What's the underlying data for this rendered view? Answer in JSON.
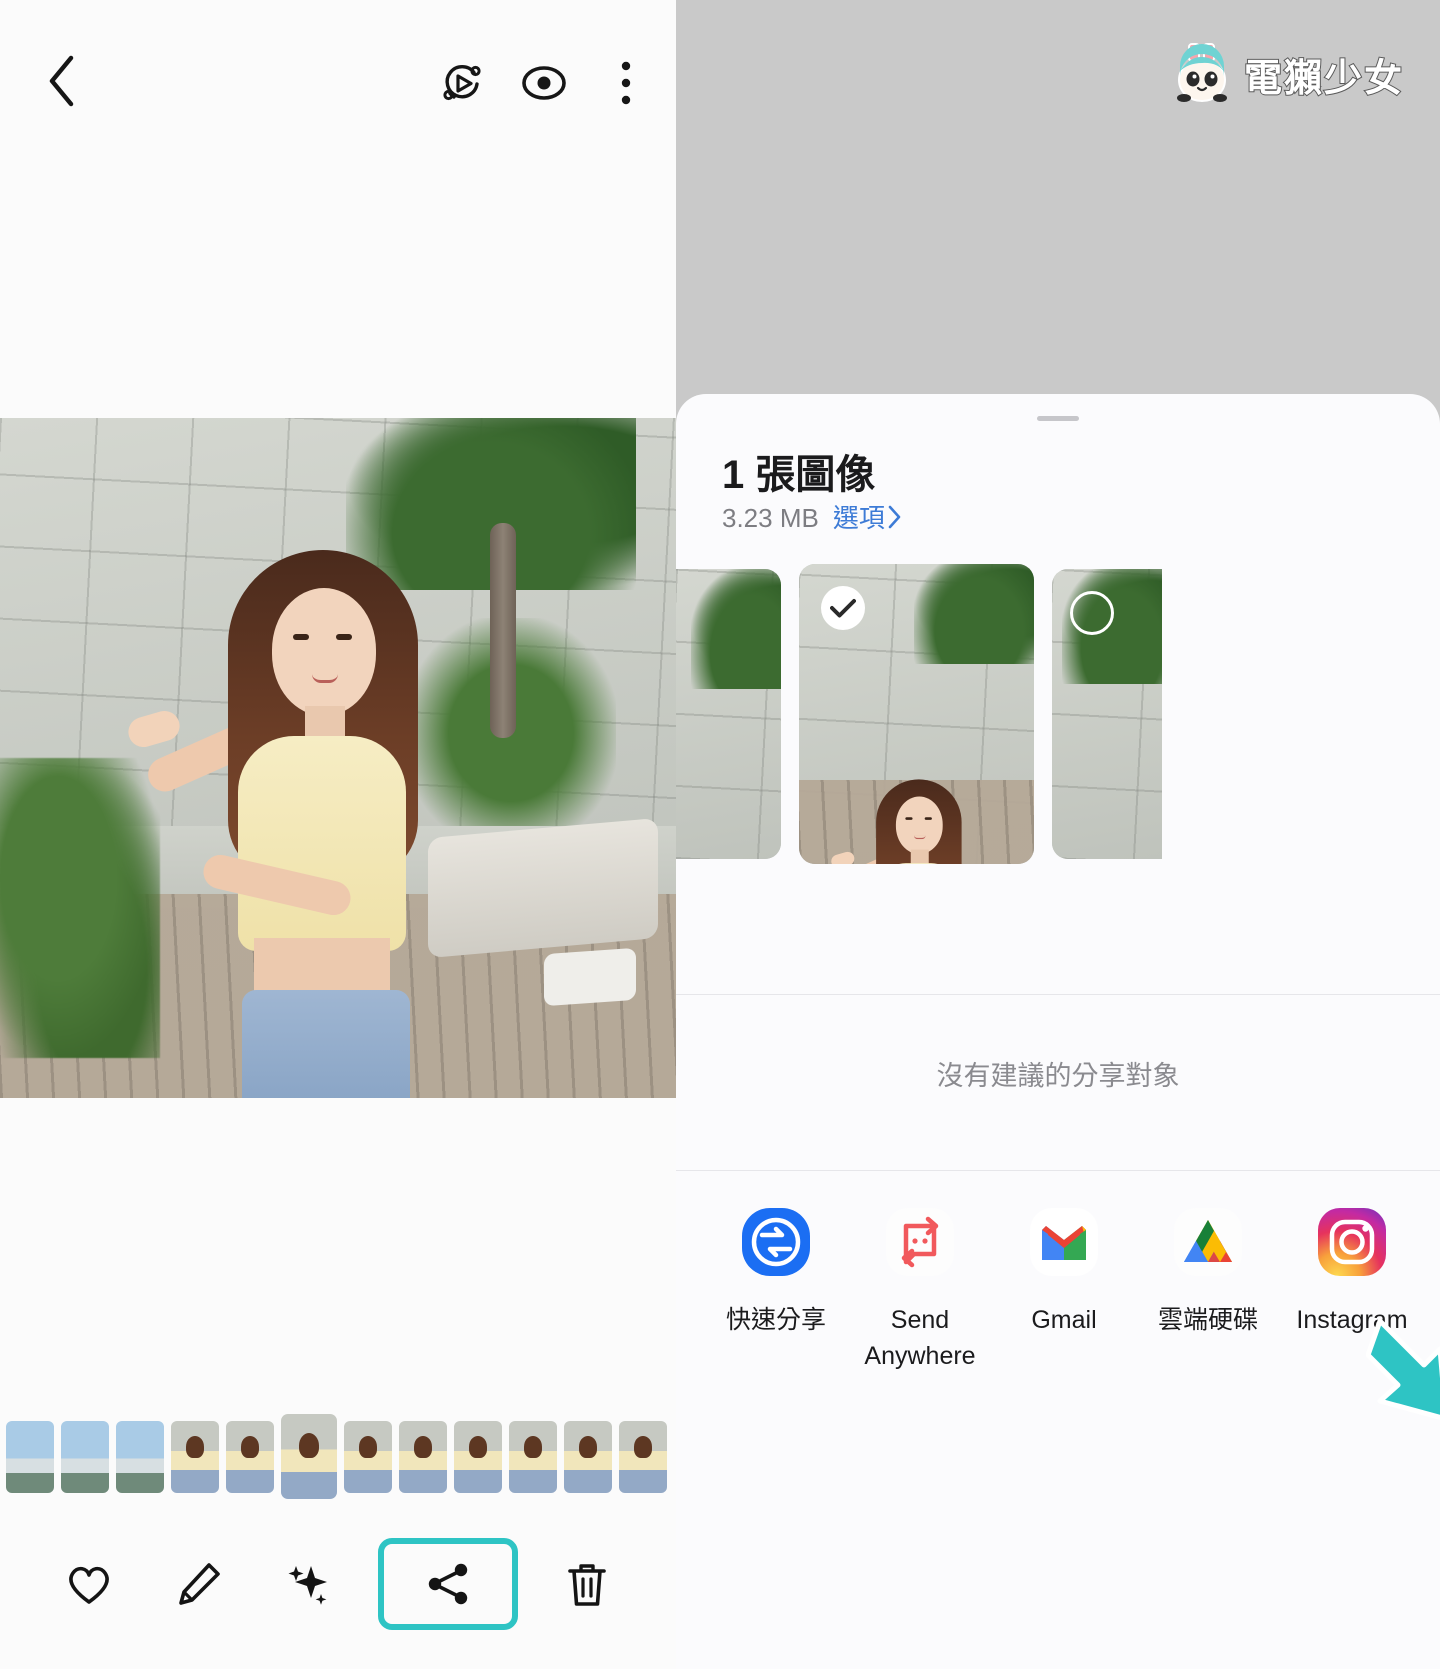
{
  "app": {
    "left_pane_name": "gallery-photo-viewer",
    "right_pane_name": "android-share-sheet"
  },
  "viewer": {
    "toolbar": {
      "back_label": "返回",
      "icons": [
        {
          "name": "back-chevron-icon",
          "label": "返回"
        },
        {
          "name": "motion-photo-icon",
          "label": "動態相片"
        },
        {
          "name": "eye-icon",
          "label": "檢視"
        },
        {
          "name": "overflow-menu-icon",
          "label": "更多選項"
        }
      ]
    },
    "bottom_actions": [
      {
        "name": "favorite-heart-icon",
        "label": "我的最愛",
        "highlighted": false
      },
      {
        "name": "edit-pencil-icon",
        "label": "編輯",
        "highlighted": false
      },
      {
        "name": "ai-sparkle-icon",
        "label": "智慧修圖",
        "highlighted": false
      },
      {
        "name": "share-icon",
        "label": "分享",
        "highlighted": true
      },
      {
        "name": "delete-trash-icon",
        "label": "刪除",
        "highlighted": false
      }
    ],
    "filmstrip": [
      {
        "type": "landscape"
      },
      {
        "type": "landscape"
      },
      {
        "type": "landscape"
      },
      {
        "type": "portrait"
      },
      {
        "type": "portrait"
      },
      {
        "type": "portrait",
        "current": true
      },
      {
        "type": "portrait"
      },
      {
        "type": "portrait"
      },
      {
        "type": "portrait"
      },
      {
        "type": "portrait"
      },
      {
        "type": "portrait"
      }
    ]
  },
  "watermark": {
    "text": "電獺少女",
    "mascot_name": "otter-girl-mascot"
  },
  "share_sheet": {
    "grabber_name": "sheet-drag-handle",
    "title": "1 張圖像",
    "size": "3.23 MB",
    "options_label": "選項",
    "options_chevron": "›",
    "selected_count": 1,
    "thumbnails": [
      {
        "position": "partial-left",
        "selected": false,
        "badge": "none"
      },
      {
        "position": "main",
        "selected": true,
        "badge": "check"
      },
      {
        "position": "partial-right",
        "selected": false,
        "badge": "ring"
      }
    ],
    "no_suggestions_text": "沒有建議的分享對象",
    "apps": [
      {
        "name": "quick-share",
        "label": "快速分享",
        "icon": "quick-share-icon",
        "color": "#1b6ef3"
      },
      {
        "name": "send-anywhere",
        "label": "Send Anywhere",
        "icon": "send-anywhere-icon",
        "color": "#f1595c"
      },
      {
        "name": "gmail",
        "label": "Gmail",
        "icon": "gmail-icon",
        "color": "#ea4335"
      },
      {
        "name": "google-drive",
        "label": "雲端硬碟",
        "icon": "google-drive-icon",
        "color": "#ffc107"
      },
      {
        "name": "instagram",
        "label": "Instagram",
        "icon": "instagram-icon",
        "color": "#d6249f"
      }
    ]
  },
  "annotations": {
    "highlight_color": "#2ec4c4",
    "arrow_name": "teal-pointer-arrow",
    "arrow_target": "quick-share"
  }
}
